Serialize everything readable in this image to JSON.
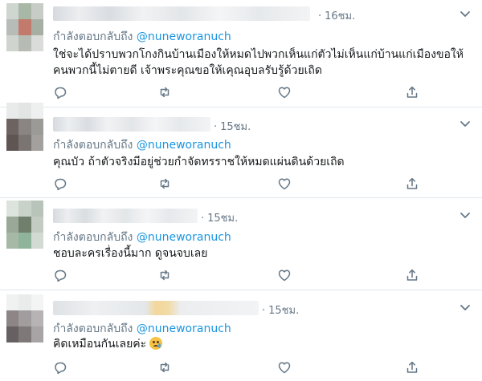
{
  "tweets": [
    {
      "time": "16ชม.",
      "reply_prefix": "กำลังตอบกลับถึง",
      "mention": "@nuneworanuch",
      "text_lines": [
        "ใช่จะได้ปราบพวกโกงกินบ้านเมืองให้หมดไปพวกเห็นแก่ตัวไม่เห็นแก่บ้านแก่เมืองขอให้",
        "คนพวกนี้ไม่ตายดี เจ้าพระคุณขอให้เคุณอุบลรับรู้ด้วยเถิด"
      ],
      "avatar_colors": [
        "#cfd5cf",
        "#a9b7a7",
        "#c7ccc6",
        "#b8bcb8",
        "#c17a6c",
        "#a7afa4",
        "#d0d4cf",
        "#b6bcb4",
        "#d9dcd8"
      ]
    },
    {
      "time": "15ชม.",
      "reply_prefix": "กำลังตอบกลับถึง",
      "mention": "@nuneworanuch",
      "text_lines": [
        "คุณบัว ถ้าตัวจริงมีอยู่ช่วยกำจัดทรราชให้หมดแผ่นดินด้วยเถิด"
      ],
      "avatar_colors": [
        "#e9ebea",
        "#e3e5e4",
        "#eeefef",
        "#6d6360",
        "#8a8483",
        "#9c9a97",
        "#5f5653",
        "#7a7472",
        "#a3a09d"
      ]
    },
    {
      "time": "15ชม.",
      "reply_prefix": "กำลังตอบกลับถึง",
      "mention": "@nuneworanuch",
      "text_lines": [
        "ชอบละครเรื่องนี้มาก ดูจนจบเลย"
      ],
      "avatar_colors": [
        "#dde3dd",
        "#c9d2c9",
        "#b8c4b9",
        "#9aa898",
        "#6f7f6c",
        "#c3cbc2",
        "#a6b9a6",
        "#8fb49c",
        "#d3dad3"
      ]
    },
    {
      "time": "15ชม.",
      "reply_prefix": "กำลังตอบกลับถึง",
      "mention": "@nuneworanuch",
      "text_lines": [
        "คิดเหมือนกันเลยค่ะ"
      ],
      "has_emoji": true,
      "emoji": "crying-face",
      "avatar_colors": [
        "#f0f1f1",
        "#eaecec",
        "#f3f4f4",
        "#8d8586",
        "#a19c9d",
        "#b7b3b4",
        "#666062",
        "#7e7879",
        "#a8a4a5"
      ]
    }
  ],
  "colors": {
    "link": "#1b95e0",
    "muted": "#657786",
    "divider": "#e1e8ed"
  },
  "icons": [
    "reply-icon",
    "retweet-icon",
    "like-icon",
    "share-icon",
    "chevron-down-icon"
  ]
}
